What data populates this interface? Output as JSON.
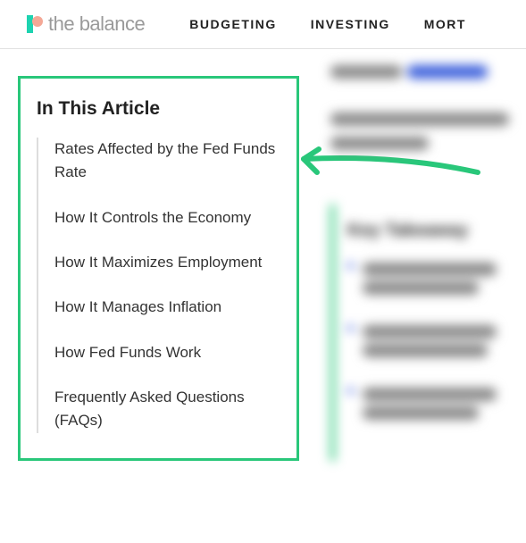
{
  "header": {
    "brand": "the balance",
    "nav": {
      "item0": "BUDGETING",
      "item1": "INVESTING",
      "item2": "MORT"
    }
  },
  "toc": {
    "title": "In This Article",
    "item0": "Rates Affected by the Fed Funds Rate",
    "item1": "How It Controls the Economy",
    "item2": "How It Maximizes Employment",
    "item3": "How It Manages Inflation",
    "item4": "How Fed Funds Work",
    "item5": "Frequently Asked Questions (FAQs)"
  },
  "blurred": {
    "key_title": "Key Takeaway"
  }
}
